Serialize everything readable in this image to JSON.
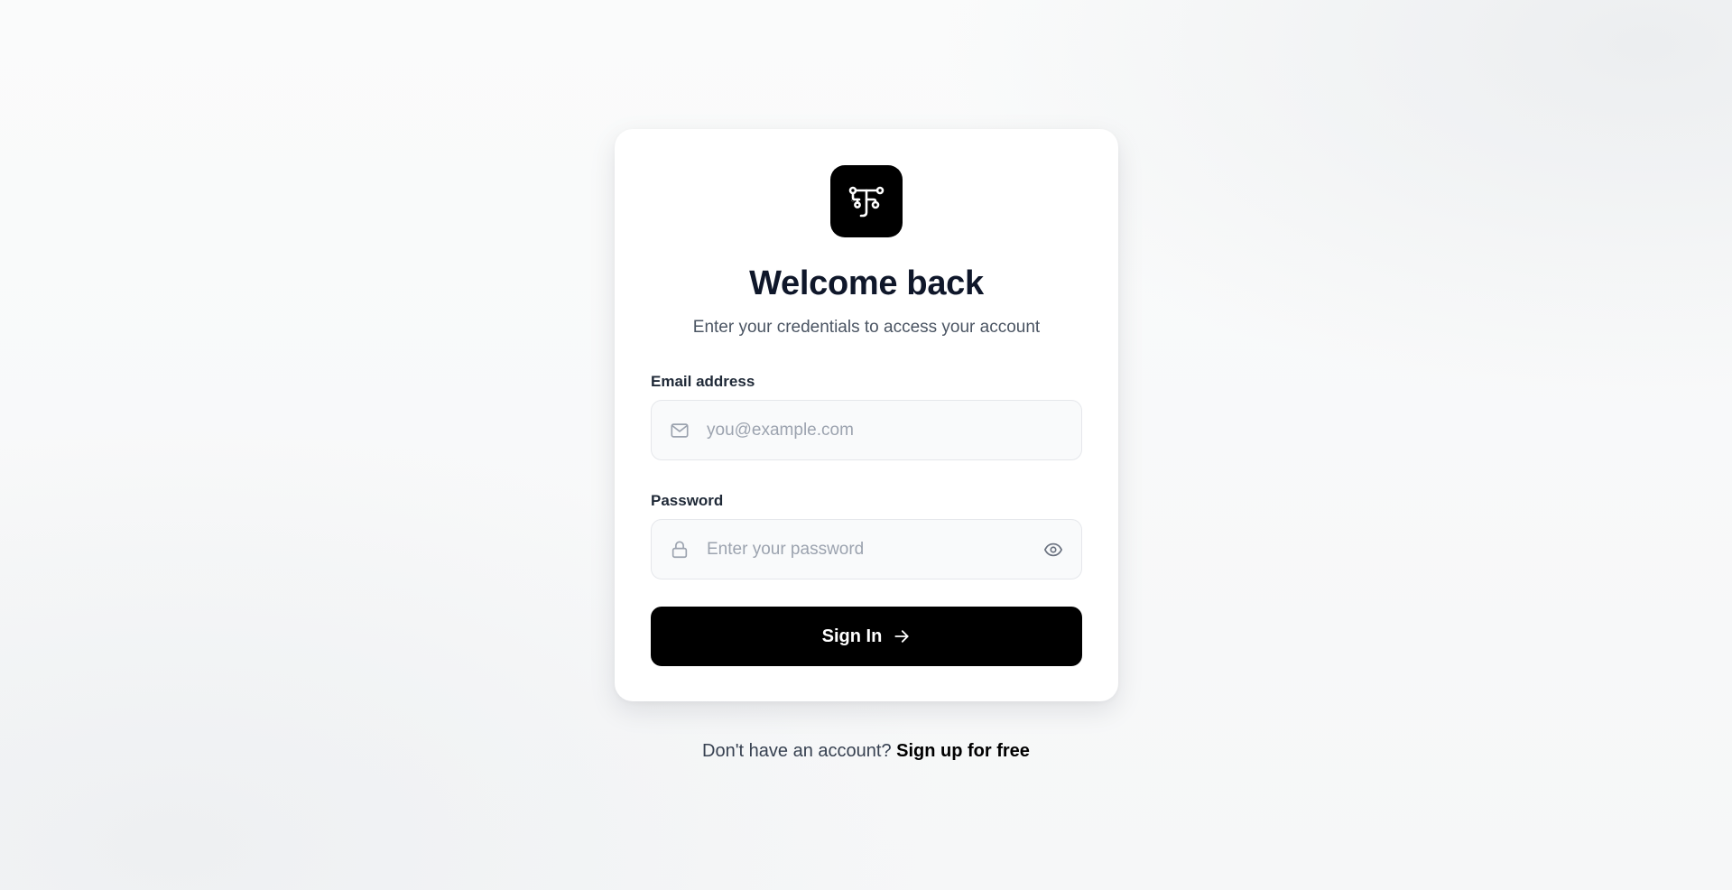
{
  "header": {
    "logo_icon": "stylized-t-circuit-logo",
    "title": "Welcome back",
    "subtitle": "Enter your credentials to access your account"
  },
  "form": {
    "email": {
      "label": "Email address",
      "placeholder": "you@example.com",
      "value": "",
      "icon": "mail-icon"
    },
    "password": {
      "label": "Password",
      "placeholder": "Enter your password",
      "value": "",
      "icon": "lock-icon",
      "toggle_icon": "eye-icon"
    },
    "submit": {
      "label": "Sign In",
      "icon": "arrow-right-icon"
    }
  },
  "footer": {
    "prompt": "Don't have an account?",
    "link_label": "Sign up for free"
  },
  "colors": {
    "primary": "#000000",
    "title": "#0f172a",
    "muted": "#4b5563",
    "placeholder": "#9ca3af",
    "field_bg": "#f9fafb",
    "field_border": "#e5e7eb"
  }
}
